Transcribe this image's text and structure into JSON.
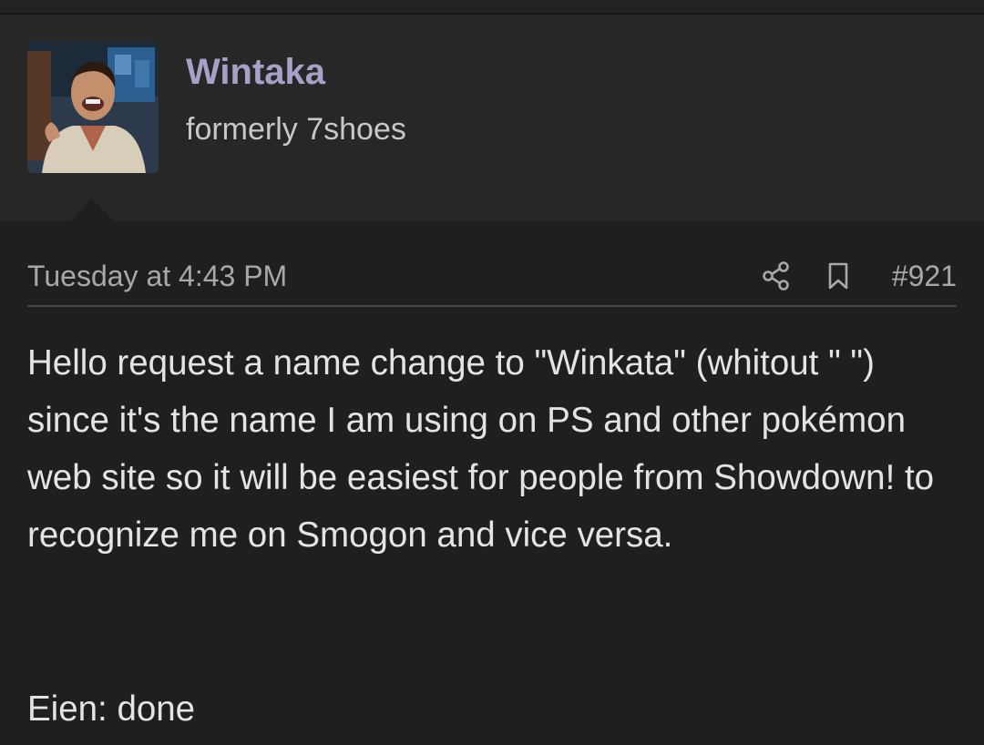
{
  "user": {
    "name": "Wintaka",
    "title": "formerly 7shoes"
  },
  "post": {
    "date": "Tuesday at 4:43 PM",
    "number": "#921",
    "body": "Hello request a name change to \"Winkata\" (whitout \" \") since it's the name I am using on PS and other pokémon web site so it will be easiest for people from Showdown! to recognize me on Smogon and vice versa.",
    "reply": "Eien: done"
  },
  "icons": {
    "share": "share-icon",
    "bookmark": "bookmark-icon"
  },
  "colors": {
    "background": "#1f1f1f",
    "user_block": "#272727",
    "username": "#a9a0c8",
    "text": "#e4e4e4",
    "muted": "#a8a8a8"
  }
}
